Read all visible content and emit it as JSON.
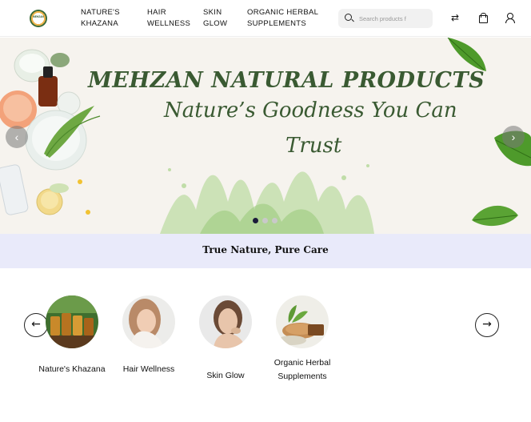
{
  "header": {
    "logo_text": "MEHZAN",
    "nav": [
      {
        "label": "NATURE'S KHAZANA"
      },
      {
        "label": "HAIR WELLNESS"
      },
      {
        "label": "SKIN GLOW"
      },
      {
        "label": "ORGANIC HERBAL SUPPLEMENTS"
      }
    ],
    "search_placeholder": "Search products f",
    "icons": [
      "compare-icon",
      "bag-icon",
      "user-icon"
    ]
  },
  "hero": {
    "title": "MEHZAN NATURAL PRODUCTS",
    "subtitle_line1": "Nature’s Goodness You Can",
    "subtitle_line2": "Trust",
    "prev_glyph": "‹",
    "next_glyph": "›",
    "slide_count": 3,
    "active_slide": 1
  },
  "tagline": "True Nature, Pure Care",
  "categories": {
    "prev_glyph": "←",
    "next_glyph": "→",
    "items": [
      {
        "label": "Nature's Khazana"
      },
      {
        "label": "Hair Wellness"
      },
      {
        "label": "Skin Glow"
      },
      {
        "label": "Organic Herbal Supplements"
      }
    ]
  },
  "colors": {
    "hero_text": "#3a5a32",
    "hero_bg": "#f6f3ee",
    "tagline_bg": "#e9eafa",
    "active_dot": "#1b1b3a"
  }
}
